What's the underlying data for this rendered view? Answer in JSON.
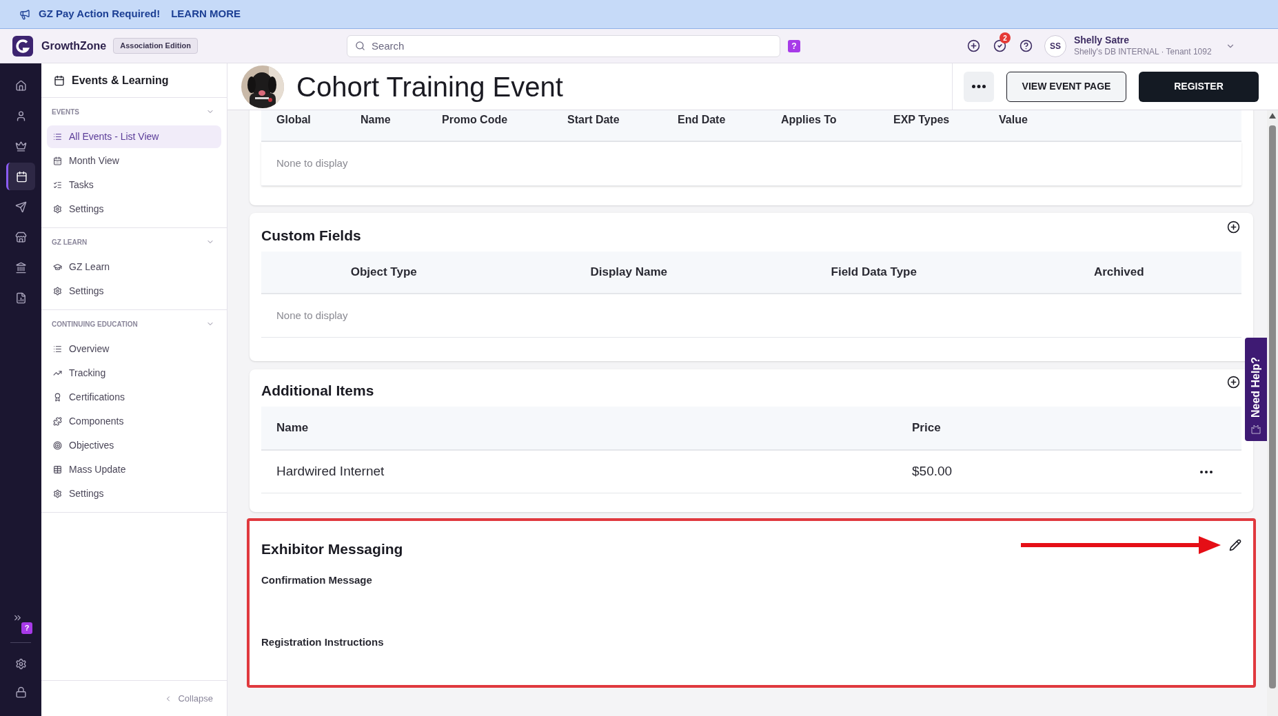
{
  "banner": {
    "text": "GZ Pay Action Required!",
    "link": "LEARN MORE"
  },
  "topbar": {
    "brand": "GrowthZone",
    "edition": "Association Edition",
    "search": {
      "placeholder": "Search"
    },
    "help_badge": "?",
    "notification_count": "2",
    "user": {
      "initials": "SS",
      "name": "Shelly Satre",
      "subtitle": "Shelly's DB INTERNAL · Tenant 1092"
    }
  },
  "rail": {
    "items": [
      {
        "selected": false
      },
      {
        "selected": false
      },
      {
        "selected": false
      },
      {
        "selected": true
      },
      {
        "selected": false
      },
      {
        "selected": false
      },
      {
        "selected": false
      },
      {
        "selected": false
      }
    ],
    "help_badge": "?"
  },
  "sidebar": {
    "title": "Events & Learning",
    "sections": [
      {
        "heading": "EVENTS",
        "expanded": true,
        "items": [
          {
            "label": "All Events - List View",
            "selected": true
          },
          {
            "label": "Month View",
            "selected": false
          },
          {
            "label": "Tasks",
            "selected": false
          },
          {
            "label": "Settings",
            "selected": false
          }
        ]
      },
      {
        "heading": "GZ LEARN",
        "expanded": true,
        "items": [
          {
            "label": "GZ Learn",
            "selected": false
          },
          {
            "label": "Settings",
            "selected": false
          }
        ]
      },
      {
        "heading": "CONTINUING EDUCATION",
        "expanded": true,
        "items": [
          {
            "label": "Overview",
            "selected": false
          },
          {
            "label": "Tracking",
            "selected": false
          },
          {
            "label": "Certifications",
            "selected": false
          },
          {
            "label": "Components",
            "selected": false
          },
          {
            "label": "Objectives",
            "selected": false
          },
          {
            "label": "Mass Update",
            "selected": false
          },
          {
            "label": "Settings",
            "selected": false
          }
        ]
      }
    ],
    "collapse": "Collapse"
  },
  "event": {
    "title": "Cohort Training Event",
    "buttons": [
      {
        "label": "VIEW EVENT PAGE",
        "kind": "outline"
      },
      {
        "label": "REGISTER",
        "kind": "primary"
      }
    ]
  },
  "promo_table": {
    "columns": [
      "Global",
      "Name",
      "Promo Code",
      "Start Date",
      "End Date",
      "Applies To",
      "EXP Types",
      "Value"
    ],
    "empty": "None to display"
  },
  "custom_fields": {
    "title": "Custom Fields",
    "columns": [
      "Object Type",
      "Display Name",
      "Field Data Type",
      "Archived"
    ],
    "empty": "None to display"
  },
  "additional_items": {
    "title": "Additional Items",
    "columns": [
      "Name",
      "Price"
    ],
    "rows": [
      {
        "name": "Hardwired Internet",
        "price": "$50.00"
      }
    ]
  },
  "exhibitor_messaging": {
    "title": "Exhibitor Messaging",
    "highlighted": true,
    "fields": [
      "Confirmation Message",
      "Registration Instructions"
    ]
  },
  "need_help": "Need Help?"
}
